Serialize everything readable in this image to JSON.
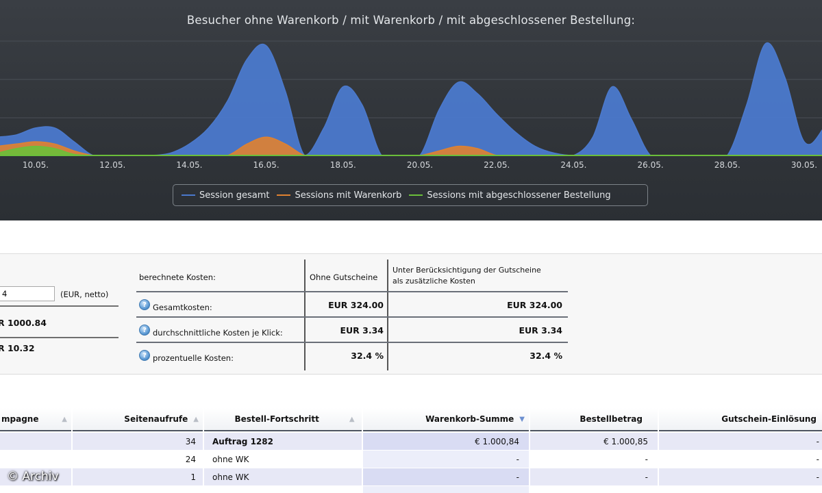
{
  "chart_data": {
    "type": "area",
    "title": "Besucher ohne Warenkorb / mit Warenkorb / mit abgeschlossener Bestellung:",
    "x_tick_labels": [
      "10.05.",
      "12.05.",
      "14.05.",
      "16.05.",
      "18.05.",
      "20.05.",
      "22.05.",
      "24.05.",
      "26.05.",
      "28.05.",
      "30.05."
    ],
    "x": [
      9,
      9.5,
      10,
      10.5,
      11,
      11.5,
      12,
      12.5,
      13,
      13.5,
      14,
      14.5,
      15,
      15.5,
      16,
      16.5,
      17,
      17.5,
      18,
      18.5,
      19,
      19.5,
      20,
      20.5,
      21,
      21.5,
      22,
      22.5,
      23,
      23.5,
      24,
      24.5,
      25,
      25.5,
      26,
      26.5,
      27,
      27.5,
      28,
      28.5,
      29,
      29.5,
      30,
      30.5,
      31
    ],
    "series": [
      {
        "name": "Session gesamt",
        "color": "#4b79cc",
        "values": [
          0.8,
          0.9,
          1.2,
          1.2,
          0.6,
          0,
          0,
          0,
          0,
          0.1,
          0.5,
          1.2,
          2.4,
          4.2,
          4.8,
          2.8,
          0,
          1.2,
          3.0,
          2.2,
          0,
          0,
          0,
          2.0,
          3.2,
          2.7,
          1.8,
          1.0,
          0.4,
          0.1,
          0,
          0.8,
          3.0,
          1.6,
          0,
          0,
          0,
          0,
          0,
          2.2,
          4.9,
          3.4,
          0.6,
          1.2,
          3.2
        ]
      },
      {
        "name": "Sessions mit Warenkorb",
        "color": "#e08230",
        "values": [
          0.4,
          0.5,
          0.6,
          0.5,
          0.2,
          0,
          0,
          0,
          0,
          0,
          0,
          0,
          0,
          0.5,
          0.8,
          0.5,
          0,
          0,
          0,
          0,
          0,
          0,
          0,
          0.2,
          0.4,
          0.3,
          0,
          0,
          0,
          0,
          0,
          0,
          0,
          0,
          0,
          0,
          0,
          0,
          0,
          0,
          0,
          0,
          0,
          0,
          0
        ]
      },
      {
        "name": "Sessions mit abgeschlossener Bestellung",
        "color": "#6bbf3a",
        "values": [
          0.1,
          0.3,
          0.4,
          0.3,
          0.05,
          0,
          0,
          0,
          0,
          0,
          0,
          0,
          0,
          0,
          0,
          0,
          0,
          0,
          0,
          0,
          0,
          0,
          0,
          0,
          0,
          0,
          0,
          0,
          0,
          0,
          0,
          0,
          0,
          0,
          0,
          0,
          0,
          0,
          0,
          0,
          0,
          0,
          0,
          0,
          0
        ]
      }
    ],
    "grid": true,
    "legend_position": "bottom-center"
  },
  "legend": {
    "items": [
      {
        "label": "Session gesamt",
        "color": "#4b79cc"
      },
      {
        "label": "Sessions mit Warenkorb",
        "color": "#e08230"
      },
      {
        "label": "Sessions mit abgeschlossener Bestellung",
        "color": "#6bbf3a"
      }
    ]
  },
  "cost": {
    "budget_value": "4",
    "budget_unit": "(EUR, netto)",
    "left_values": [
      "R 1000.84",
      "R 10.32"
    ],
    "table": {
      "header_label": "berechnete Kosten:",
      "col1_header": "Ohne Gutscheine",
      "col2_header_line1": "Unter Berücksichtigung der Gutscheine",
      "col2_header_line2": "als zusätzliche Kosten",
      "rows": [
        {
          "label": "Gesamtkosten:",
          "col1": "EUR 324.00",
          "col2": "EUR 324.00"
        },
        {
          "label": "durchschnittliche Kosten je Klick:",
          "col1": "EUR 3.34",
          "col2": "EUR 3.34"
        },
        {
          "label": "prozentuelle Kosten:",
          "col1": "32.4 %",
          "col2": "32.4 %"
        }
      ]
    }
  },
  "data_table": {
    "headers": [
      "mpagne",
      "Seitenaufrufe",
      "Bestell-Fortschritt",
      "Warenkorb-Summe",
      "Bestellbetrag",
      "Gutschein-Einlösung"
    ],
    "rows": [
      {
        "seitenaufrufe": "34",
        "fortschritt": "Auftrag 1282",
        "warenkorb": "€ 1.000,84",
        "bestellbetrag": "€ 1.000,85",
        "gutschein": "-"
      },
      {
        "seitenaufrufe": "24",
        "fortschritt": "ohne WK",
        "warenkorb": "-",
        "bestellbetrag": "-",
        "gutschein": "-"
      },
      {
        "seitenaufrufe": "1",
        "fortschritt": "ohne WK",
        "warenkorb": "-",
        "bestellbetrag": "-",
        "gutschein": "-"
      }
    ]
  },
  "watermark": "© Archiv"
}
